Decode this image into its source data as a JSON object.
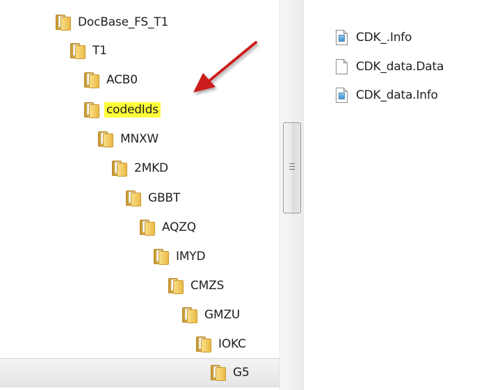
{
  "tree": {
    "items": [
      {
        "label": "DocBase_FS_T1"
      },
      {
        "label": "T1"
      },
      {
        "label": "ACB0"
      },
      {
        "label": "codedIds",
        "highlighted": true
      },
      {
        "label": "MNXW"
      },
      {
        "label": "2MKD"
      },
      {
        "label": "GBBT"
      },
      {
        "label": "AQZQ"
      },
      {
        "label": "IMYD"
      },
      {
        "label": "CMZS"
      },
      {
        "label": "GMZU"
      },
      {
        "label": "IOKC"
      },
      {
        "label": "G5",
        "selected": true
      }
    ]
  },
  "files": {
    "items": [
      {
        "label": "CDK_.Info",
        "icon": "info-file-icon"
      },
      {
        "label": "CDK_data.Data",
        "icon": "blank-file-icon"
      },
      {
        "label": "CDK_data.Info",
        "icon": "info-file-icon"
      }
    ]
  },
  "annotation": {
    "arrow_color": "#cc1f1f",
    "highlight_color": "#ffff39"
  }
}
